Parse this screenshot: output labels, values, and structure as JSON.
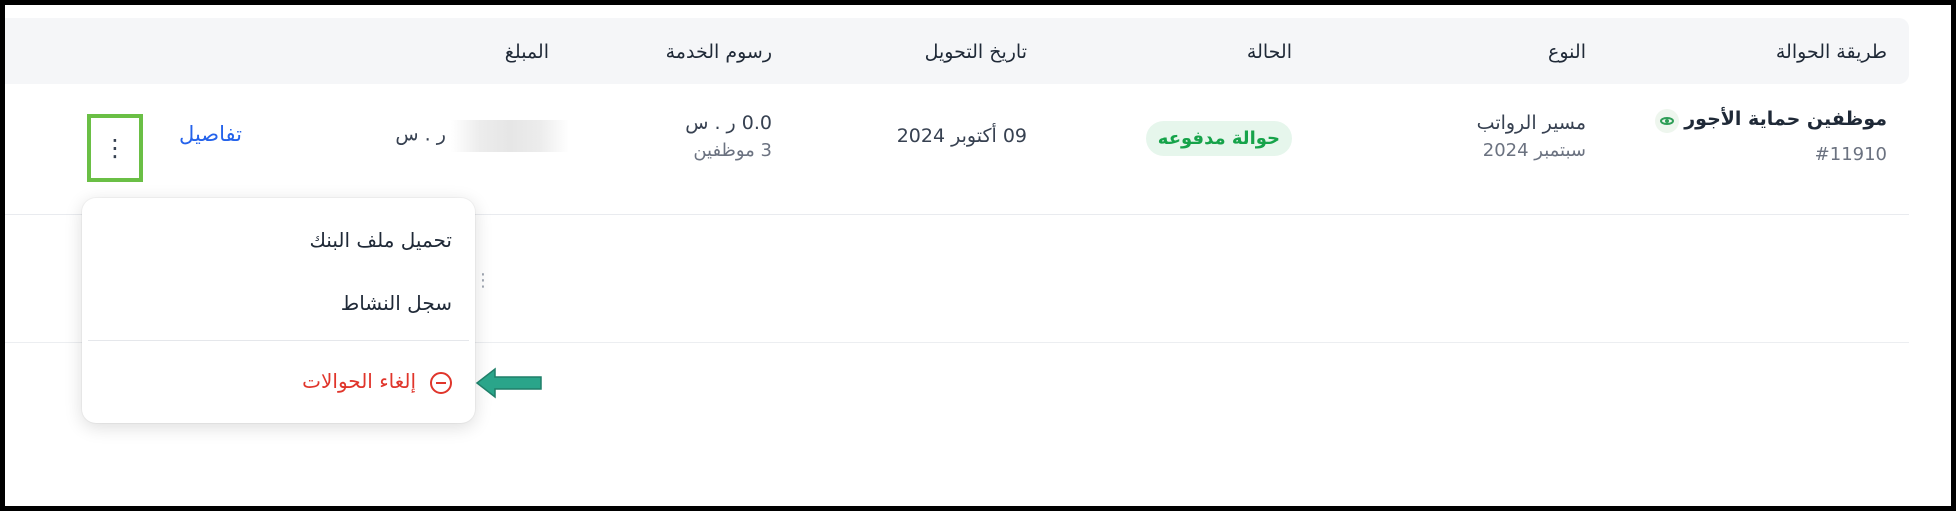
{
  "headers": {
    "method": "طريقة الحوالة",
    "type": "النوع",
    "status": "الحالة",
    "date": "تاريخ التحويل",
    "fees": "رسوم الخدمة",
    "amount": "المبلغ"
  },
  "row": {
    "title": "موظفين حماية الأجور",
    "id": "#11910",
    "type_main": "مسير الرواتب",
    "type_sub": "سبتمبر 2024",
    "status": "حوالة مدفوعه",
    "date": "09 أكتوبر 2024",
    "fee_value": "0.0 ر . س",
    "fee_sub": "3 موظفين",
    "amount_currency": "ر . س",
    "details": "تفاصيل"
  },
  "menu": {
    "items": [
      "تحميل ملف البنك",
      "سجل النشاط"
    ],
    "cancel": "إلغاء الحوالات"
  },
  "colors": {
    "success": "#16a34a",
    "danger": "#e0352b",
    "link": "#2563eb",
    "highlight": "#6abf45",
    "arrow": "#2aa58a"
  }
}
